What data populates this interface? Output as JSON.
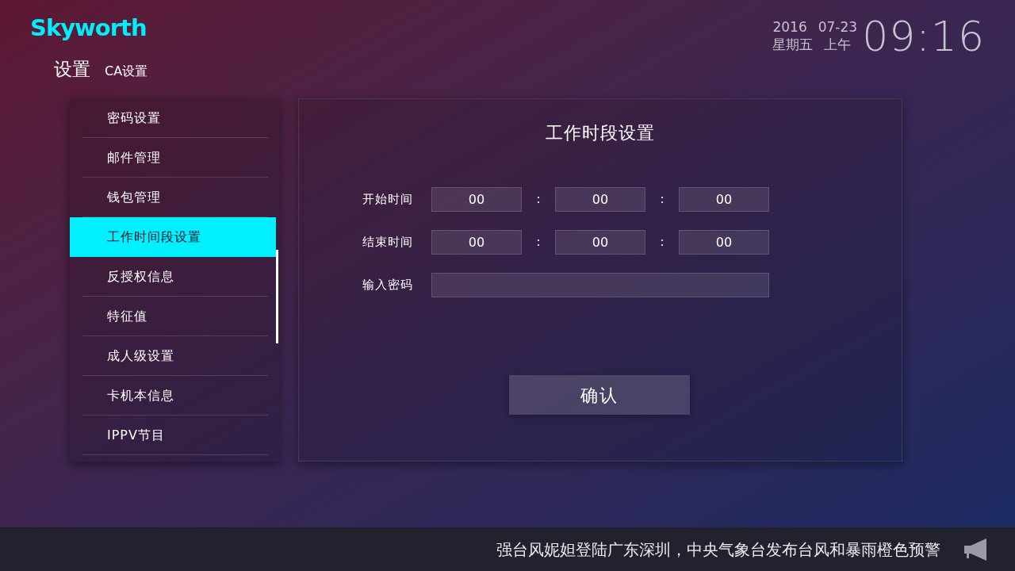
{
  "logo": {
    "text": "Skyworth"
  },
  "breadcrumb": {
    "title": "设置",
    "subtitle": "CA设置"
  },
  "clock": {
    "year": "2016",
    "date": "07-23",
    "weekday": "星期五",
    "period": "上午",
    "time": "09:16"
  },
  "sidebar": {
    "items": [
      {
        "label": "密码设置",
        "selected": false
      },
      {
        "label": "邮件管理",
        "selected": false
      },
      {
        "label": "钱包管理",
        "selected": false
      },
      {
        "label": "工作时间段设置",
        "selected": true
      },
      {
        "label": "反授权信息",
        "selected": false
      },
      {
        "label": "特征值",
        "selected": false
      },
      {
        "label": "成人级设置",
        "selected": false
      },
      {
        "label": "卡机本信息",
        "selected": false
      },
      {
        "label": "IPPV节目",
        "selected": false
      }
    ]
  },
  "form": {
    "title": "工作时段设置",
    "time_rows": [
      {
        "label": "开始时间",
        "values": [
          "00",
          "00",
          "00"
        ],
        "separators": [
          ":",
          ":"
        ]
      },
      {
        "label": "结束时间",
        "values": [
          "00",
          "00",
          "00"
        ],
        "separators": [
          ":",
          ":"
        ]
      }
    ],
    "password": {
      "label": "输入密码"
    },
    "confirm_button": "确认"
  },
  "ticker": {
    "text": "强台风妮妲登陆广东深圳，中央气象台发布台风和暴雨橙色预警"
  }
}
